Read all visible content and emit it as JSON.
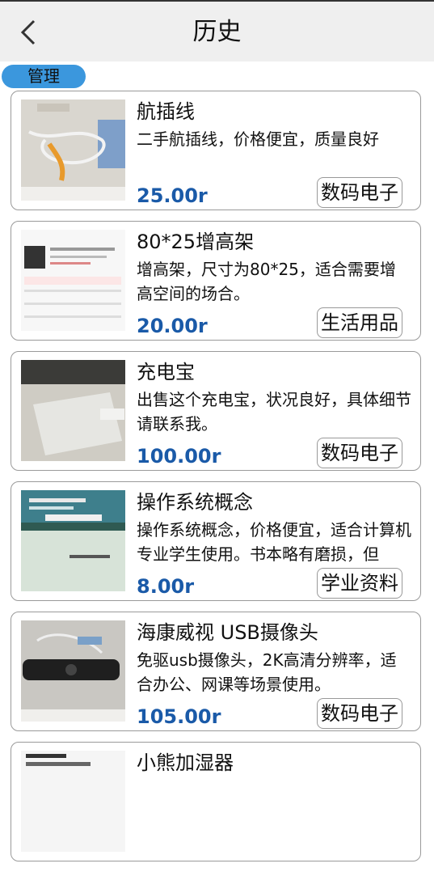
{
  "header": {
    "title": "历史",
    "back_icon": "chevron-left-icon"
  },
  "manage_label": "管理",
  "items": [
    {
      "name": "航插线",
      "desc": "二手航插线，价格便宜，质量良好",
      "price": "25.00r",
      "tag": "数码电子"
    },
    {
      "name": "80*25增高架",
      "desc": "增高架，尺寸为80*25，适合需要增高空间的场合。",
      "price": "20.00r",
      "tag": "生活用品"
    },
    {
      "name": "充电宝",
      "desc": "出售这个充电宝，状况良好，具体细节请联系我。",
      "price": "100.00r",
      "tag": "数码电子"
    },
    {
      "name": "操作系统概念",
      "desc": "操作系统概念，价格便宜，适合计算机专业学生使用。书本略有磨损，但",
      "price": "8.00r",
      "tag": "学业资料"
    },
    {
      "name": "海康威视 USB摄像头",
      "desc": "免驱usb摄像头，2K高清分辨率，适合办公、网课等场景使用。",
      "price": "105.00r",
      "tag": "数码电子"
    },
    {
      "name": "小熊加湿器",
      "desc": "",
      "price": "",
      "tag": ""
    }
  ]
}
